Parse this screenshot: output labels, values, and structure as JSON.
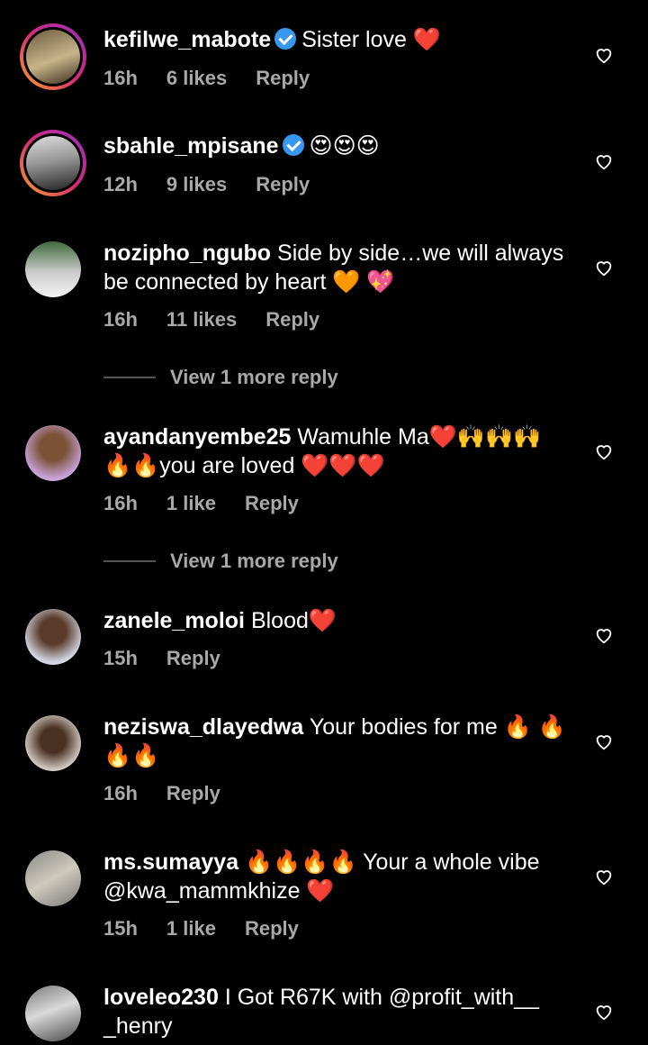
{
  "comments": [
    {
      "user": "kefilwe_mabote",
      "verified": true,
      "text": "Sister love ❤️",
      "time": "16h",
      "likes": "6 likes",
      "reply": "Reply"
    },
    {
      "user": "sbahle_mpisane",
      "verified": true,
      "text": "😍😍😍",
      "time": "12h",
      "likes": "9 likes",
      "reply": "Reply"
    },
    {
      "user": "nozipho_ngubo",
      "verified": false,
      "text": "Side by side…we will always be connected by heart 🧡 💖",
      "time": "16h",
      "likes": "11 likes",
      "reply": "Reply"
    },
    {
      "user": "ayandanyembe25",
      "verified": false,
      "text": "Wamuhle Ma❤️🙌🙌🙌 🔥🔥you are loved ❤️❤️❤️",
      "time": "16h",
      "likes": "1 like",
      "reply": "Reply"
    },
    {
      "user": "zanele_moloi",
      "verified": false,
      "text": "Blood❤️",
      "time": "15h",
      "likes": "",
      "reply": "Reply"
    },
    {
      "user": "neziswa_dlayedwa",
      "verified": false,
      "text": "Your bodies for me 🔥 🔥🔥🔥",
      "time": "16h",
      "likes": "",
      "reply": "Reply"
    },
    {
      "user": "ms.sumayya",
      "verified": false,
      "text": "🔥🔥🔥🔥 Your a whole vibe @kwa_mammkhize ❤️",
      "time": "15h",
      "likes": "1 like",
      "reply": "Reply"
    },
    {
      "user": "loveleo230",
      "verified": false,
      "text": "I Got R67K with @profit_with__ _henry",
      "time": "",
      "likes": "",
      "reply": ""
    }
  ],
  "view_more_1": "View 1 more reply",
  "view_more_2": "View 1 more reply",
  "colors": {
    "background": "#000000",
    "text": "#ffffff",
    "meta": "#a8a8a8",
    "verified": "#3897f0"
  }
}
